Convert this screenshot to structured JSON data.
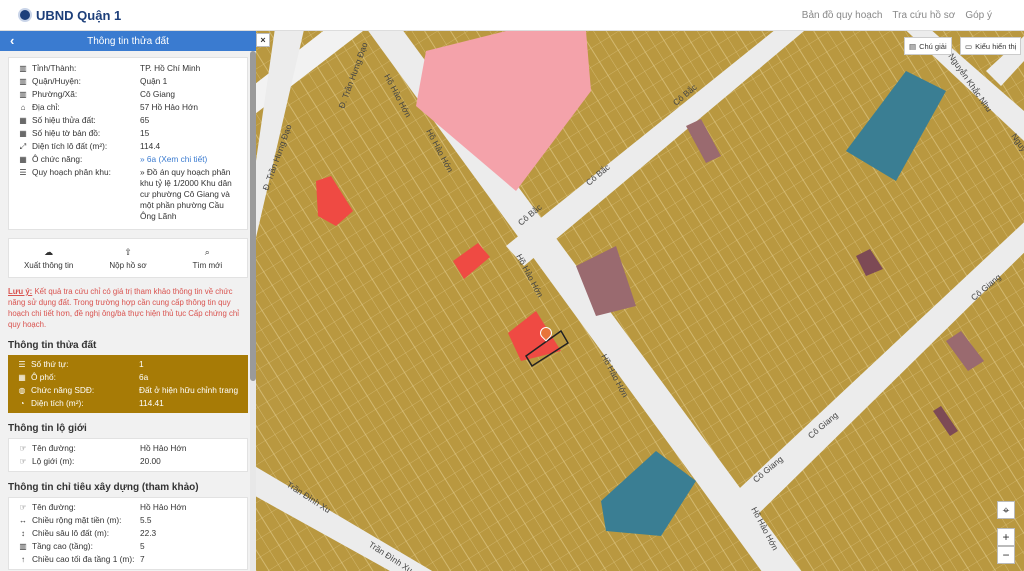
{
  "app": {
    "title": "UBND Quận 1",
    "nav": [
      "Bản đồ quy hoạch",
      "Tra cứu hồ sơ",
      "Góp ý"
    ]
  },
  "panel": {
    "back_icon": "chevron-left-icon",
    "title": "Thông tin thửa đất",
    "location_rows": [
      {
        "icon": "building-icon",
        "label": "Tỉnh/Thành:",
        "value": "TP. Hồ Chí Minh"
      },
      {
        "icon": "building-icon",
        "label": "Quận/Huyện:",
        "value": "Quận 1"
      },
      {
        "icon": "building-icon",
        "label": "Phường/Xã:",
        "value": "Cô Giang"
      },
      {
        "icon": "home-icon",
        "label": "Địa chỉ:",
        "value": "57 Hồ Hảo Hớn"
      },
      {
        "icon": "map-icon",
        "label": "Số hiệu thửa đất:",
        "value": "65"
      },
      {
        "icon": "map-icon",
        "label": "Số hiệu tờ bản đồ:",
        "value": "15"
      },
      {
        "icon": "expand-icon",
        "label": "Diện tích lô đất (m²):",
        "value": "114.4"
      },
      {
        "icon": "grid-icon",
        "label": "Ô chức năng:",
        "value": "»   6a (Xem chi tiết)",
        "link": true
      },
      {
        "icon": "list-icon",
        "label": "Quy hoạch phân khu:",
        "value": "»   Đồ án quy hoạch phân khu tỷ lệ 1/2000 Khu dân cư phường Cô Giang và một phần phường Cầu Ông Lãnh"
      }
    ],
    "actions": [
      {
        "icon": "cloud-download-icon",
        "label": "Xuất thông tin"
      },
      {
        "icon": "upload-icon",
        "label": "Nộp hồ sơ"
      },
      {
        "icon": "search-icon",
        "label": "Tìm mới"
      }
    ],
    "note_label": "Lưu ý:",
    "note_text": " Kết quả tra cứu chỉ có giá trị tham khảo thông tin về chức năng sử dụng đất. Trong trường hợp cần cung cấp thông tin quy hoạch chi tiết hơn, đề nghị ông/bà thực hiện thủ tục Cấp chứng chỉ quy hoạch.",
    "parcel_section": "Thông tin thửa đất",
    "parcel_rows": [
      {
        "icon": "list-icon",
        "label": "Số thứ tự:",
        "value": "1"
      },
      {
        "icon": "grid-icon",
        "label": "Ô phố:",
        "value": "6a"
      },
      {
        "icon": "globe-icon",
        "label": "Chức năng SDĐ:",
        "value": "Đất ở hiện hữu chỉnh trang"
      },
      {
        "icon": "pie-icon",
        "label": "Diện tích (m²):",
        "value": "114.41"
      }
    ],
    "boundary_section": "Thông tin lộ giới",
    "boundary_rows": [
      {
        "icon": "hand-icon",
        "label": "Tên đường:",
        "value": "Hồ Hảo Hớn"
      },
      {
        "icon": "hand-icon",
        "label": "Lộ giới (m):",
        "value": "20.00"
      }
    ],
    "build_section": "Thông tin chỉ tiêu xây dựng (tham khảo)",
    "build_rows": [
      {
        "icon": "hand-icon",
        "label": "Tên đường:",
        "value": "Hồ Hảo Hớn"
      },
      {
        "icon": "arrows-h-icon",
        "label": "Chiều rộng mặt tiền (m):",
        "value": "5.5"
      },
      {
        "icon": "arrows-v-icon",
        "label": "Chiều sâu lô đất (m):",
        "value": "22.3"
      },
      {
        "icon": "building-icon",
        "label": "Tầng cao (tầng):",
        "value": "5"
      },
      {
        "icon": "arrow-up-icon",
        "label": "Chiều cao tối đa tầng 1 (m):",
        "value": "7"
      }
    ]
  },
  "map": {
    "close_label": "×",
    "legend_button": "Chú giải",
    "display_button": "Kiểu hiển thị",
    "zoom_in": "+",
    "zoom_out": "−",
    "locate_icon": "crosshair-icon",
    "road_labels": {
      "tran_hung_dao_1": "Đ. Trần Hưng Đạo",
      "tran_hung_dao_2": "Đ. Trần Hưng Đạo",
      "ho_hao_hon_1": "Hồ Hảo Hớn",
      "ho_hao_hon_2": "Hồ Hảo Hớn",
      "ho_hao_hon_3": "Hồ Hảo Hớn",
      "ho_hao_hon_4": "Hồ Hảo Hớn",
      "ho_hao_hon_5": "Hồ Hảo Hớn",
      "co_bac_1": "Cô Bắc",
      "co_bac_2": "Cô Bắc",
      "co_bac_3": "Cô Bắc",
      "co_giang_1": "Cô Giang",
      "co_giang_2": "Cô Giang",
      "co_giang_3": "Cô Giang",
      "tran_dinh_xu_1": "Trần Đình Xu",
      "tran_dinh_xu_2": "Trần Đình Xu",
      "nguyen_khac_nhu": "Nguyễn Khắc Nhu",
      "nguyen": "Nguy"
    },
    "colors": {
      "residential": "#b99840",
      "road": "#ececec",
      "commercial": "#f4a2aa",
      "public": "#3a7e93",
      "mauve": "#9a6a6f",
      "red": "#ef4a43",
      "selected_outline": "#222222"
    }
  }
}
